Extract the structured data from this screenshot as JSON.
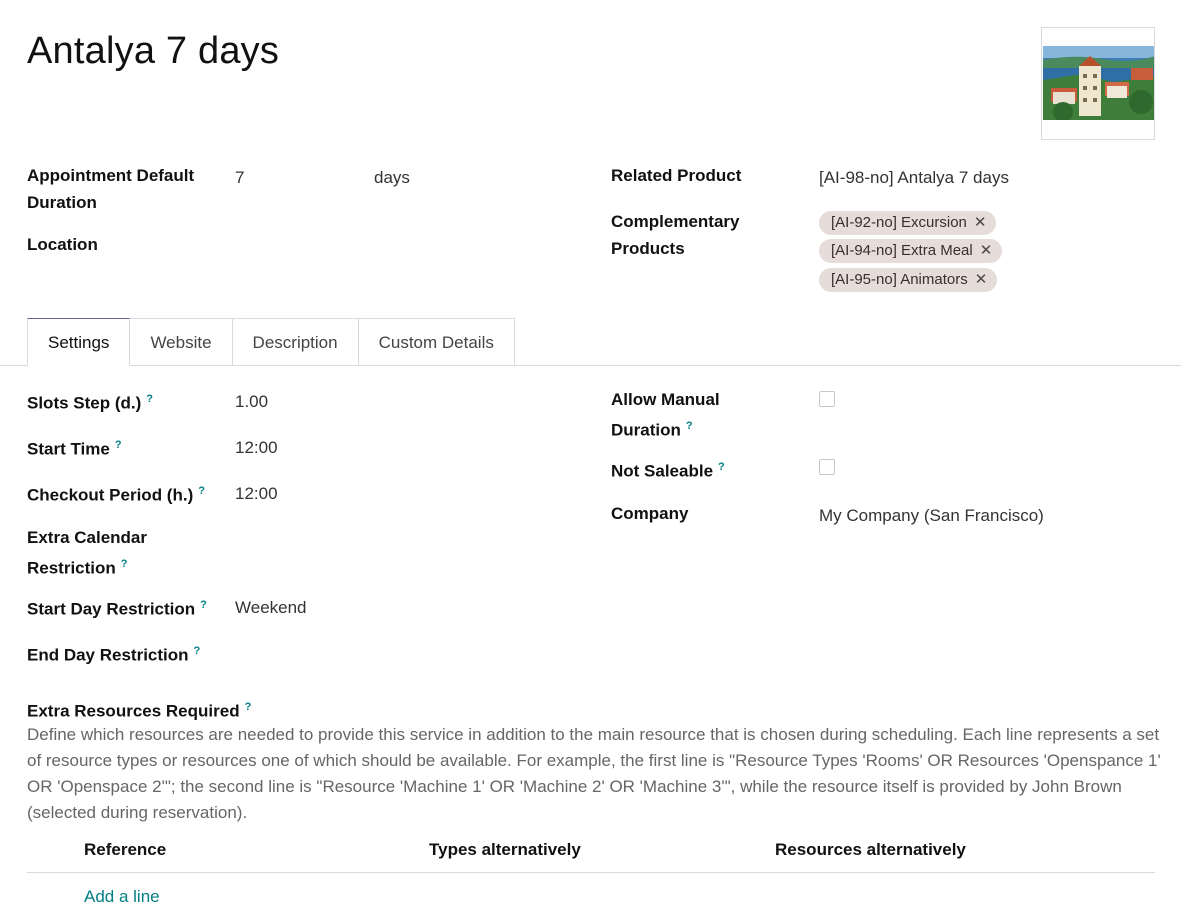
{
  "record": {
    "title": "Antalya 7 days"
  },
  "header_fields": {
    "appointment_default_duration_label": "Appointment Default Duration",
    "duration_value": "7",
    "duration_unit": "days",
    "location_label": "Location",
    "related_product_label": "Related Product",
    "related_product_value": "[AI-98-no] Antalya 7 days",
    "complementary_products_label": "Complementary Products",
    "complementary_products": [
      "[AI-92-no] Excursion",
      "[AI-94-no] Extra Meal",
      "[AI-95-no] Animators"
    ]
  },
  "tabs": [
    {
      "label": "Settings",
      "active": true
    },
    {
      "label": "Website",
      "active": false
    },
    {
      "label": "Description",
      "active": false
    },
    {
      "label": "Custom Details",
      "active": false
    }
  ],
  "settings": {
    "help_marker": "?",
    "slots_step_label": "Slots Step (d.)",
    "slots_step_value": "1.00",
    "start_time_label": "Start Time",
    "start_time_value": "12:00",
    "checkout_period_label": "Checkout Period (h.)",
    "checkout_period_value": "12:00",
    "extra_calendar_restriction_label": "Extra Calendar Restriction",
    "start_day_restriction_label": "Start Day Restriction",
    "start_day_restriction_value": "Weekend",
    "end_day_restriction_label": "End Day Restriction",
    "allow_manual_duration_label": "Allow Manual Duration",
    "allow_manual_duration_checked": false,
    "not_saleable_label": "Not Saleable",
    "not_saleable_checked": false,
    "company_label": "Company",
    "company_value": "My Company (San Francisco)"
  },
  "extra_resources": {
    "label": "Extra Resources Required",
    "description": "Define which resources are needed to provide this service in addition to the main resource that is chosen during scheduling. Each line represents a set of resource types or resources one of which should be available. For example, the first line is \"Resource Types 'Rooms' OR Resources 'Openspance 1' OR 'Openspace 2'\"; the second line is \"Resource 'Machine 1' OR 'Machine 2' OR 'Machine 3'\", while the resource itself is provided by John Brown (selected during reservation).",
    "columns": [
      "Reference",
      "Types alternatively",
      "Resources alternatively"
    ],
    "add_line_label": "Add a line"
  },
  "colors": {
    "accent": "#017e84",
    "tab_active_border": "#71639e",
    "tag_background": "#e6dcd9"
  }
}
